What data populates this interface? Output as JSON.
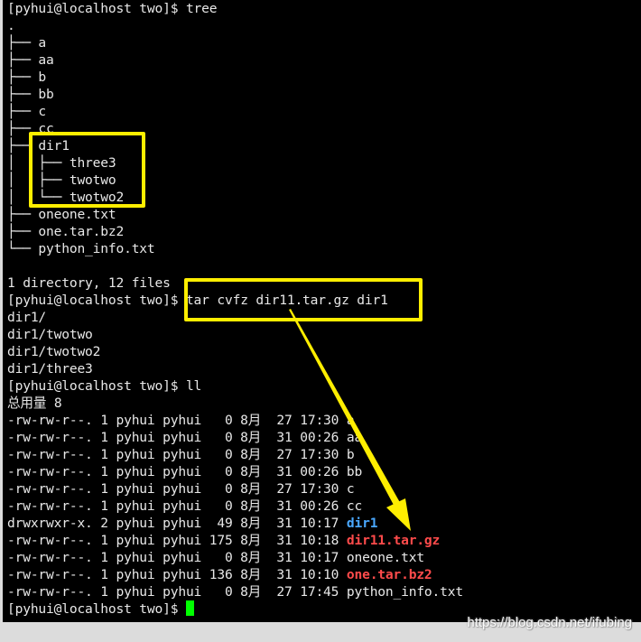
{
  "terminal": {
    "prompt": "[pyhui@localhost two]$",
    "cmd_tree": "tree",
    "tree_lines": [
      ".",
      "├── a",
      "├── aa",
      "├── b",
      "├── bb",
      "├── c",
      "├── cc",
      "├── dir1",
      "│   ├── three3",
      "│   ├── twotwo",
      "│   └── twotwo2",
      "├── oneone.txt",
      "├── one.tar.bz2",
      "└── python_info.txt"
    ],
    "tree_summary": "1 directory, 12 files",
    "cmd_tar": "tar cvfz dir11.tar.gz dir1",
    "tar_output": [
      "dir1/",
      "dir1/twotwo",
      "dir1/twotwo2",
      "dir1/three3"
    ],
    "cmd_ll": "ll",
    "total_line": "总用量 8",
    "ll_rows": [
      {
        "meta": "-rw-rw-r--. 1 pyhui pyhui   0 8月  27 17:30 ",
        "name": "a",
        "style": "normal"
      },
      {
        "meta": "-rw-rw-r--. 1 pyhui pyhui   0 8月  31 00:26 ",
        "name": "aa",
        "style": "normal"
      },
      {
        "meta": "-rw-rw-r--. 1 pyhui pyhui   0 8月  27 17:30 ",
        "name": "b",
        "style": "normal"
      },
      {
        "meta": "-rw-rw-r--. 1 pyhui pyhui   0 8月  31 00:26 ",
        "name": "bb",
        "style": "normal"
      },
      {
        "meta": "-rw-rw-r--. 1 pyhui pyhui   0 8月  27 17:30 ",
        "name": "c",
        "style": "normal"
      },
      {
        "meta": "-rw-rw-r--. 1 pyhui pyhui   0 8月  31 00:26 ",
        "name": "cc",
        "style": "normal"
      },
      {
        "meta": "drwxrwxr-x. 2 pyhui pyhui  49 8月  31 10:17 ",
        "name": "dir1",
        "style": "blue"
      },
      {
        "meta": "-rw-rw-r--. 1 pyhui pyhui 175 8月  31 10:18 ",
        "name": "dir11.tar.gz",
        "style": "red"
      },
      {
        "meta": "-rw-rw-r--. 1 pyhui pyhui   0 8月  31 10:17 ",
        "name": "oneone.txt",
        "style": "normal"
      },
      {
        "meta": "-rw-rw-r--. 1 pyhui pyhui 136 8月  31 10:10 ",
        "name": "one.tar.bz2",
        "style": "red"
      },
      {
        "meta": "-rw-rw-r--. 1 pyhui pyhui   0 8月  27 17:45 ",
        "name": "python_info.txt",
        "style": "normal"
      }
    ]
  },
  "colors": {
    "background": "#000000",
    "text": "#e8e8e8",
    "directory": "#4aa8ff",
    "archive": "#ff4b4b",
    "cursor": "#00ff00",
    "annotation": "#ffee00"
  },
  "watermark": "https://blog.csdn.net/ifubing"
}
